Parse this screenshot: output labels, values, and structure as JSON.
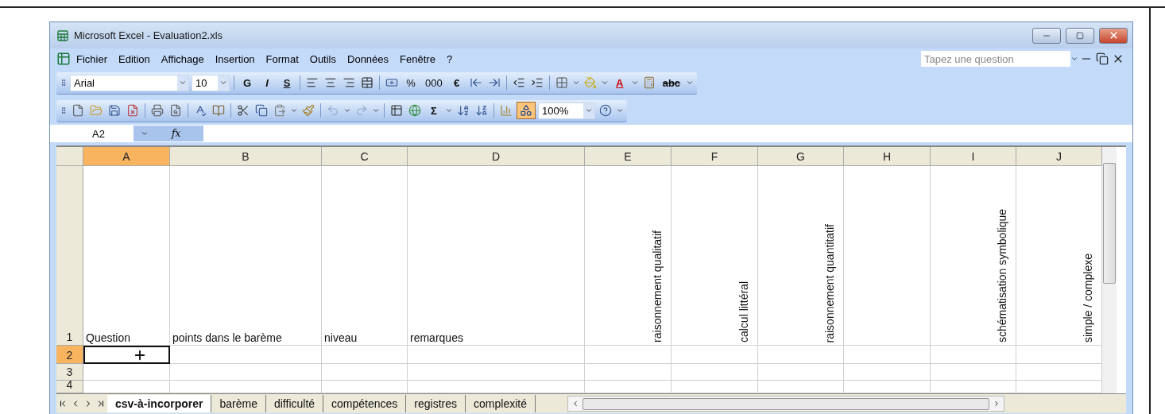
{
  "window": {
    "title": "Microsoft Excel - Evaluation2.xls"
  },
  "menu": [
    "Fichier",
    "Edition",
    "Affichage",
    "Insertion",
    "Format",
    "Outils",
    "Données",
    "Fenêtre",
    "?"
  ],
  "question_box": {
    "placeholder": "Tapez une question"
  },
  "format_toolbar": {
    "font": "Arial",
    "size": "10",
    "style_buttons": [
      "G",
      "I",
      "S"
    ],
    "number_buttons": [
      "%",
      "000",
      "€"
    ],
    "font_color_button": "A",
    "strike_button": "abc"
  },
  "standard_toolbar": {
    "sum_button": "Σ",
    "drawing_pressed": true,
    "zoom": "100%"
  },
  "formula_bar": {
    "name_box": "A2",
    "fx": "fx"
  },
  "columns": [
    {
      "letter": "A",
      "selected": true
    },
    {
      "letter": "B",
      "selected": false
    },
    {
      "letter": "C",
      "selected": false
    },
    {
      "letter": "D",
      "selected": false
    },
    {
      "letter": "E",
      "selected": false
    },
    {
      "letter": "F",
      "selected": false
    },
    {
      "letter": "G",
      "selected": false
    },
    {
      "letter": "H",
      "selected": false
    },
    {
      "letter": "I",
      "selected": false
    },
    {
      "letter": "J",
      "selected": false
    }
  ],
  "rows": [
    {
      "number": "1",
      "selected": false,
      "cells": [
        {
          "text": "Question",
          "kind": "flat"
        },
        {
          "text": "points dans le barème",
          "kind": "flat"
        },
        {
          "text": "niveau",
          "kind": "flat"
        },
        {
          "text": "remarques",
          "kind": "flat"
        },
        {
          "text": "raisonnement qualitatif",
          "kind": "vertical"
        },
        {
          "text": "calcul littéral",
          "kind": "vertical"
        },
        {
          "text": "raisonnement quantitatif",
          "kind": "vertical"
        },
        null,
        {
          "text": "schématisation symbolique",
          "kind": "vertical"
        },
        {
          "text": "simple / complexe",
          "kind": "vertical"
        }
      ]
    },
    {
      "number": "2",
      "selected": true,
      "cells": [
        {
          "selected": true
        },
        {
          "selected": false
        },
        {
          "selected": false
        },
        {
          "selected": false
        },
        {
          "selected": false
        },
        {
          "selected": false
        },
        {
          "selected": false
        },
        {
          "selected": false
        },
        {
          "selected": false
        },
        {
          "selected": false
        }
      ]
    },
    {
      "number": "3",
      "selected": false
    },
    {
      "number": "4",
      "selected": false
    }
  ],
  "sheet_tabs": [
    {
      "label": "csv-à-incorporer",
      "selected": true
    },
    {
      "label": "barème",
      "selected": false
    },
    {
      "label": "difficulté",
      "selected": false
    },
    {
      "label": "compétences",
      "selected": false
    },
    {
      "label": "registres",
      "selected": false
    },
    {
      "label": "complexité",
      "selected": false
    }
  ]
}
